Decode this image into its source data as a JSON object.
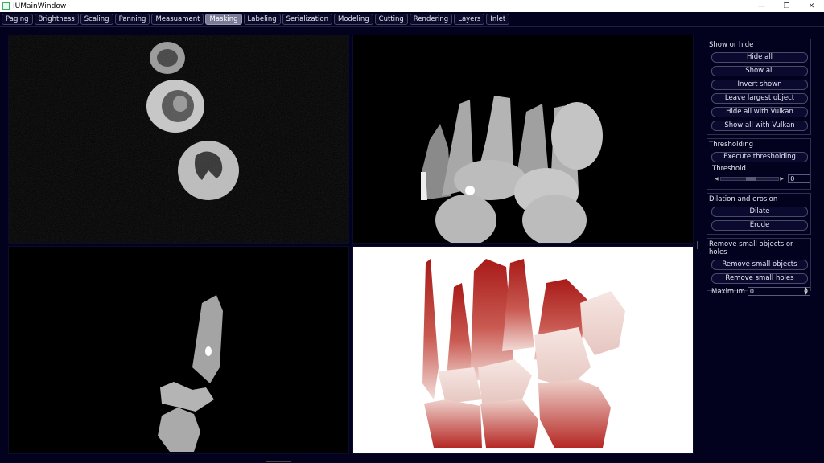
{
  "window": {
    "title": "IUMainWindow",
    "minimize": "—",
    "maximize": "❐",
    "close": "✕"
  },
  "tabs": [
    {
      "label": "Paging",
      "active": false
    },
    {
      "label": "Brightness",
      "active": false
    },
    {
      "label": "Scaling",
      "active": false
    },
    {
      "label": "Panning",
      "active": false
    },
    {
      "label": "Measuament",
      "active": false
    },
    {
      "label": "Masking",
      "active": true
    },
    {
      "label": "Labeling",
      "active": false
    },
    {
      "label": "Serialization",
      "active": false
    },
    {
      "label": "Modeling",
      "active": false
    },
    {
      "label": "Cutting",
      "active": false
    },
    {
      "label": "Rendering",
      "active": false
    },
    {
      "label": "Layers",
      "active": false
    },
    {
      "label": "Inlet",
      "active": false
    }
  ],
  "panels": {
    "show_hide": {
      "title": "Show or hide",
      "buttons": [
        "Hide all",
        "Show all",
        "Invert shown",
        "Leave largest object",
        "Hide all with Vulkan",
        "Show all with Vulkan"
      ]
    },
    "thresholding": {
      "title": "Thresholding",
      "execute_label": "Execute thresholding",
      "threshold_label": "Threshold",
      "threshold_value": "0",
      "slider_position": 0.5
    },
    "dilation": {
      "title": "Dilation and erosion",
      "buttons": [
        "Dilate",
        "Erode"
      ]
    },
    "remove": {
      "title": "Remove small objects or holes",
      "buttons": [
        "Remove small objects",
        "Remove small holes"
      ],
      "maximum_label": "Maximum",
      "maximum_value": "0"
    }
  },
  "colors": {
    "background": "#02021e",
    "active_tab": "#7b7b98",
    "render_red": "#b0201e"
  }
}
